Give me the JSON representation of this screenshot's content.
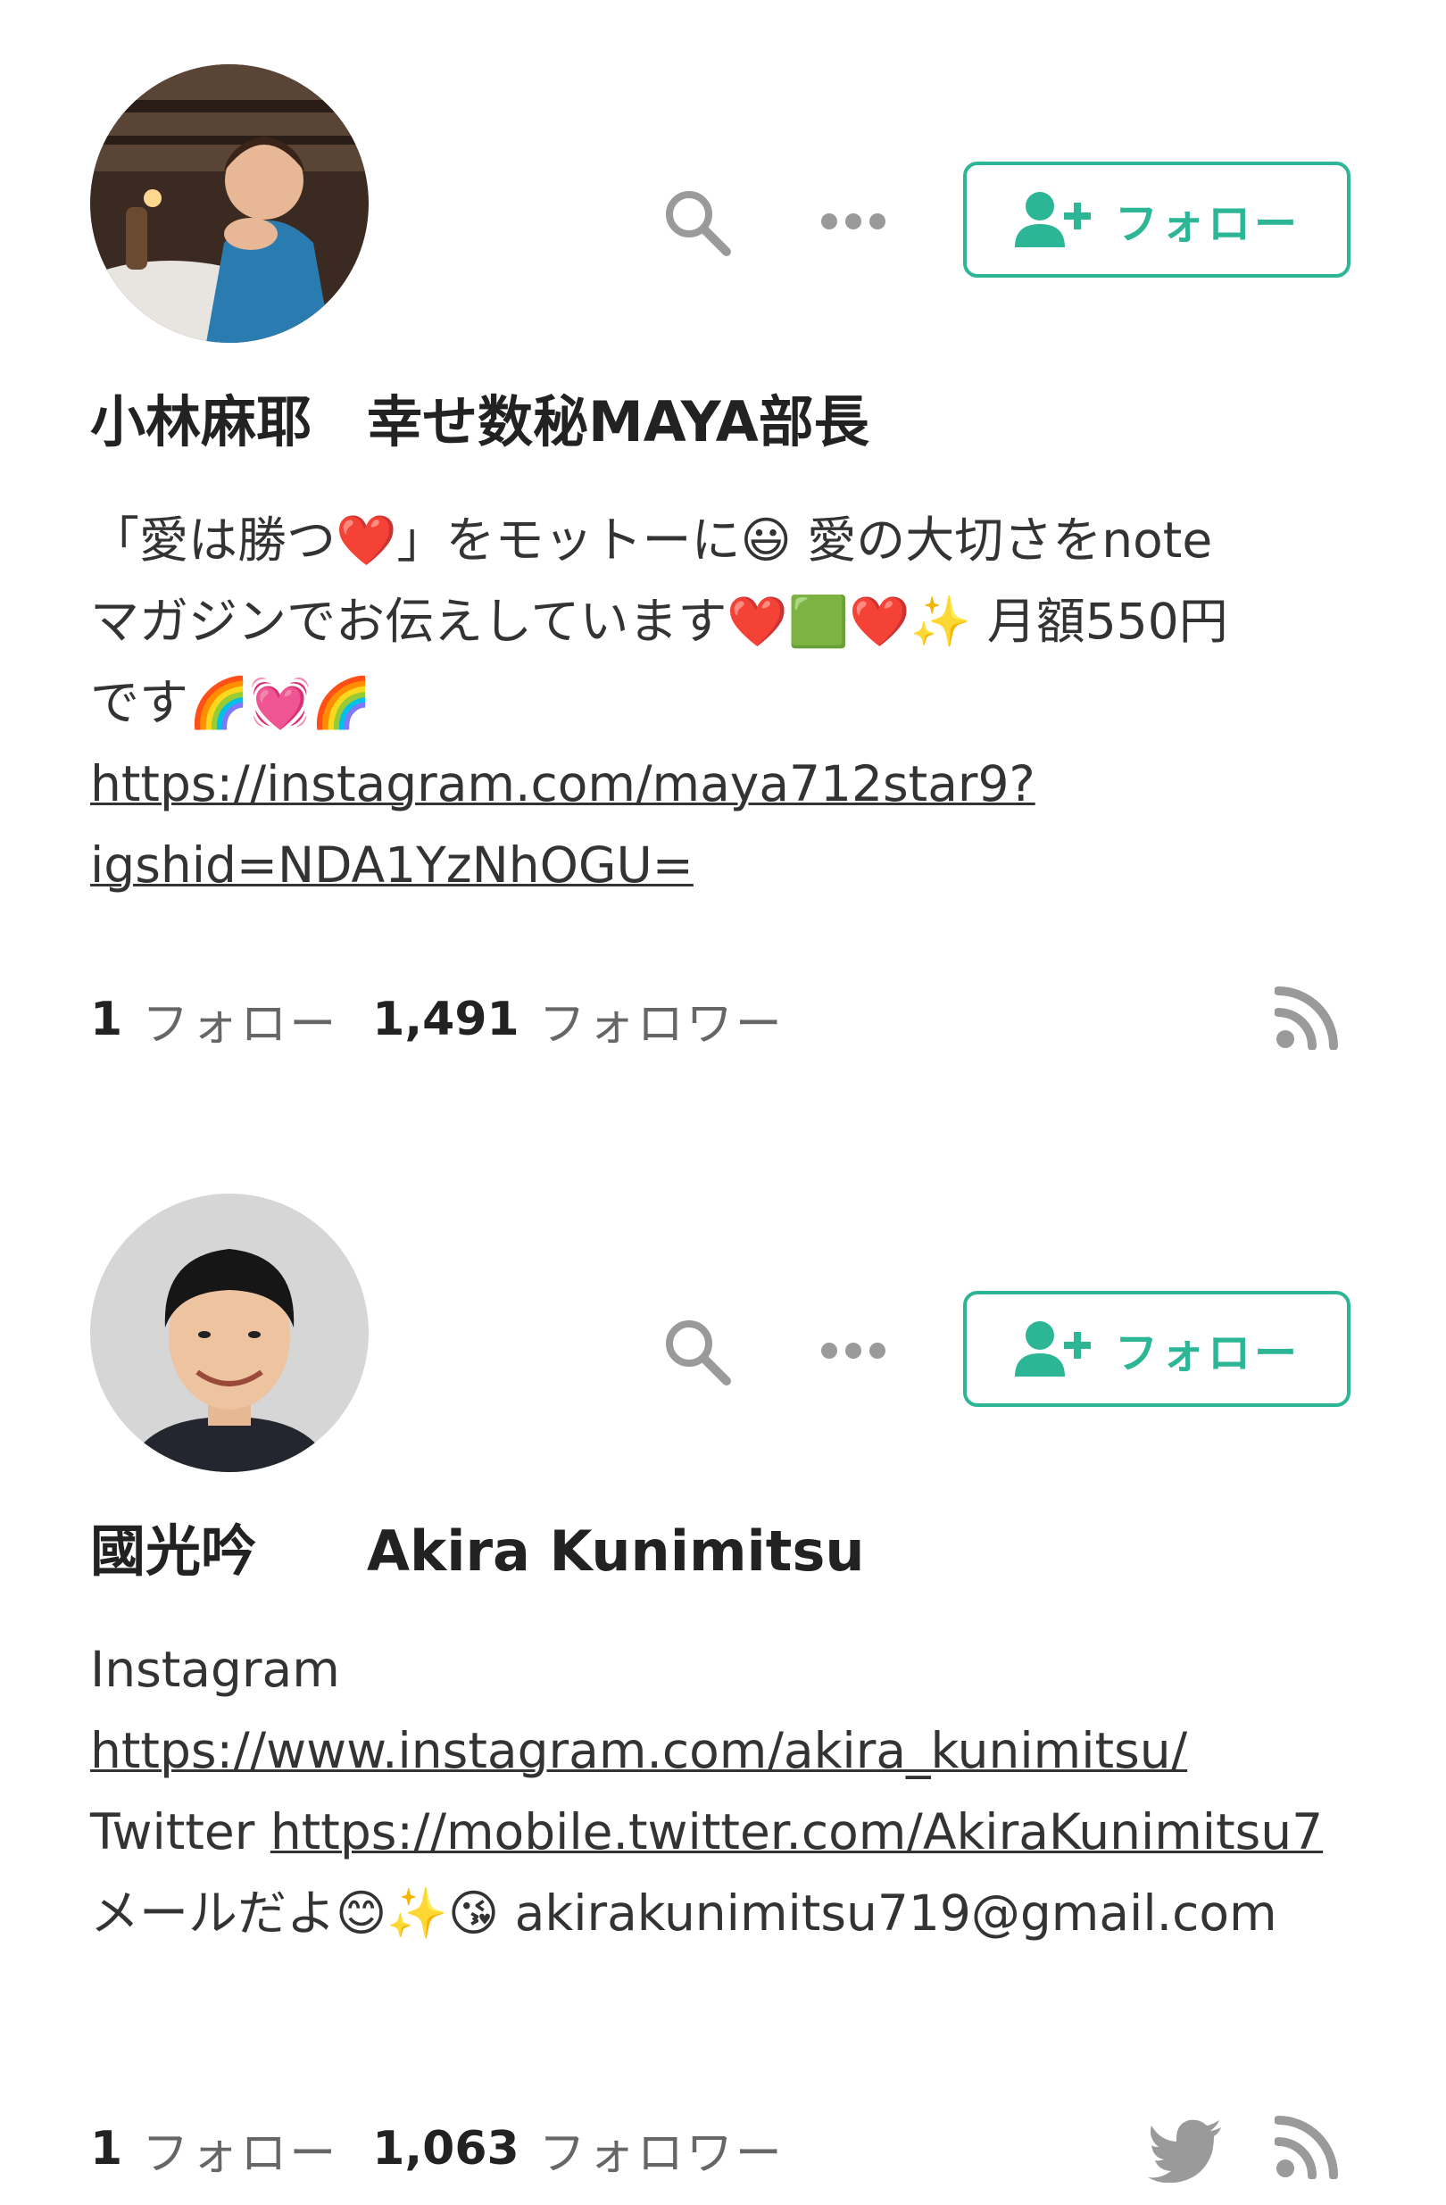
{
  "profiles": [
    {
      "name": "小林麻耶　幸せ数秘MAYA部長",
      "follow_label": "フォロー",
      "bio": [
        "「愛は勝つ❤️」をモットーに😃 愛の大切さをnote",
        "マガジンでお伝えしています❤️🟩❤️✨ 月額550円",
        "です🌈💓🌈"
      ],
      "bio_links": [
        "https://instagram.com/maya712star9?",
        "igshid=NDA1YzNhOGU="
      ],
      "following_count": "1",
      "following_label": "フォロー",
      "followers_count": "1,491",
      "followers_label": "フォロワー",
      "icons": [
        "avatar",
        "search-icon",
        "more-icon",
        "add-user-icon",
        "rss-icon"
      ]
    },
    {
      "name": "國光吟　　Akira Kunimitsu",
      "follow_label": "フォロー",
      "bio_label_instagram": "Instagram",
      "bio_link_instagram": "https://www.instagram.com/akira_kunimitsu/",
      "bio_label_twitter": "Twitter",
      "bio_link_twitter": "https://mobile.twitter.com/AkiraKunimitsu7",
      "bio_mail": "メールだよ😊✨😘 akirakunimitsu719@gmail.com",
      "following_count": "1",
      "following_label": "フォロー",
      "followers_count": "1,063",
      "followers_label": "フォロワー",
      "icons": [
        "avatar",
        "search-icon",
        "more-icon",
        "add-user-icon",
        "twitter-icon",
        "rss-icon"
      ]
    }
  ],
  "colors": {
    "accent": "#2cb696",
    "icon_gray": "#9a9a9a",
    "text": "#222222",
    "muted": "#666666"
  }
}
